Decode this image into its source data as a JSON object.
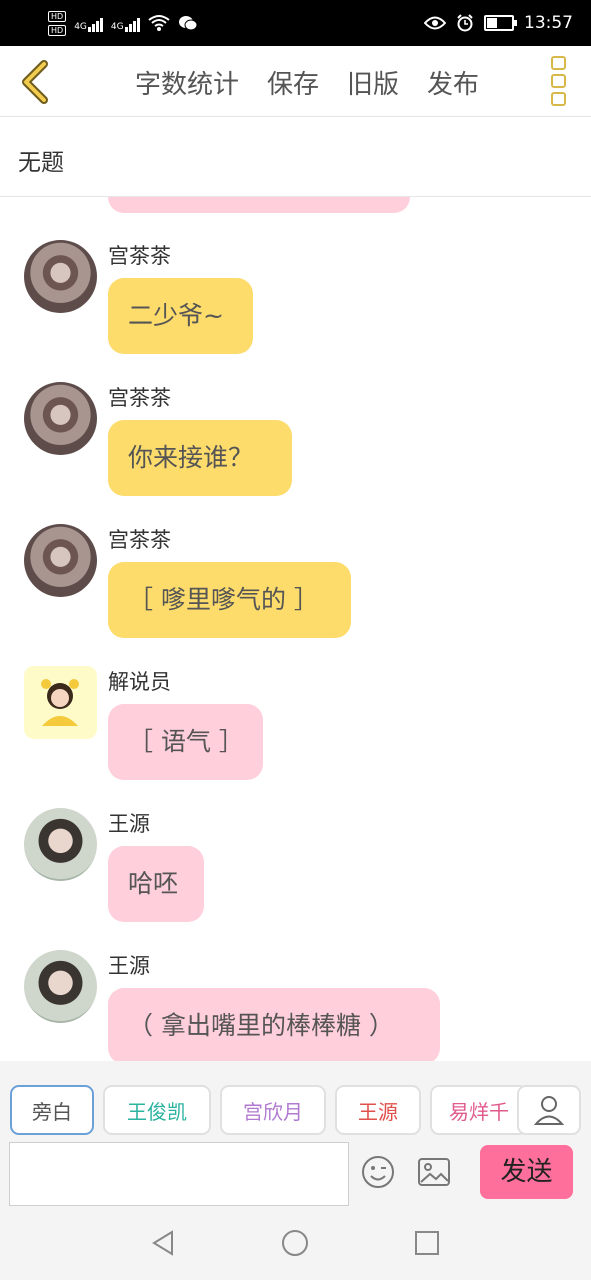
{
  "status": {
    "time": "13:57",
    "hd1": "HD",
    "hd2": "HD",
    "net1": "4G",
    "net2": "4G"
  },
  "toolbar": {
    "word_count": "字数统计",
    "save": "保存",
    "old_version": "旧版",
    "publish": "发布"
  },
  "doc_title": "无题",
  "messages": [
    {
      "name": "宫茶茶",
      "text": "二少爷~"
    },
    {
      "name": "宫茶茶",
      "text": "你来接谁？"
    },
    {
      "name": "宫茶茶",
      "text": "［ 嗲里嗲气的 ］"
    },
    {
      "name": "解说员",
      "text": "［ 语气 ］"
    },
    {
      "name": "王源",
      "text": "哈呸"
    },
    {
      "name": "王源",
      "text": "（ 拿出嘴里的棒棒糖 ）"
    }
  ],
  "roles": [
    {
      "label": "旁白",
      "color": "#555555"
    },
    {
      "label": "王俊凯",
      "color": "#2bb3a0"
    },
    {
      "label": "宫欣月",
      "color": "#b07ad0"
    },
    {
      "label": "王源",
      "color": "#e0504a"
    },
    {
      "label": "易烊千",
      "color": "#e05a8c"
    }
  ],
  "composer": {
    "input_value": "",
    "send_label": "发送"
  },
  "colors": {
    "accent_send": "#ff6f9c",
    "bubble_yellow": "#fddc6b",
    "bubble_pink": "#ffcfdc",
    "menu_gold": "#d9b84a"
  }
}
